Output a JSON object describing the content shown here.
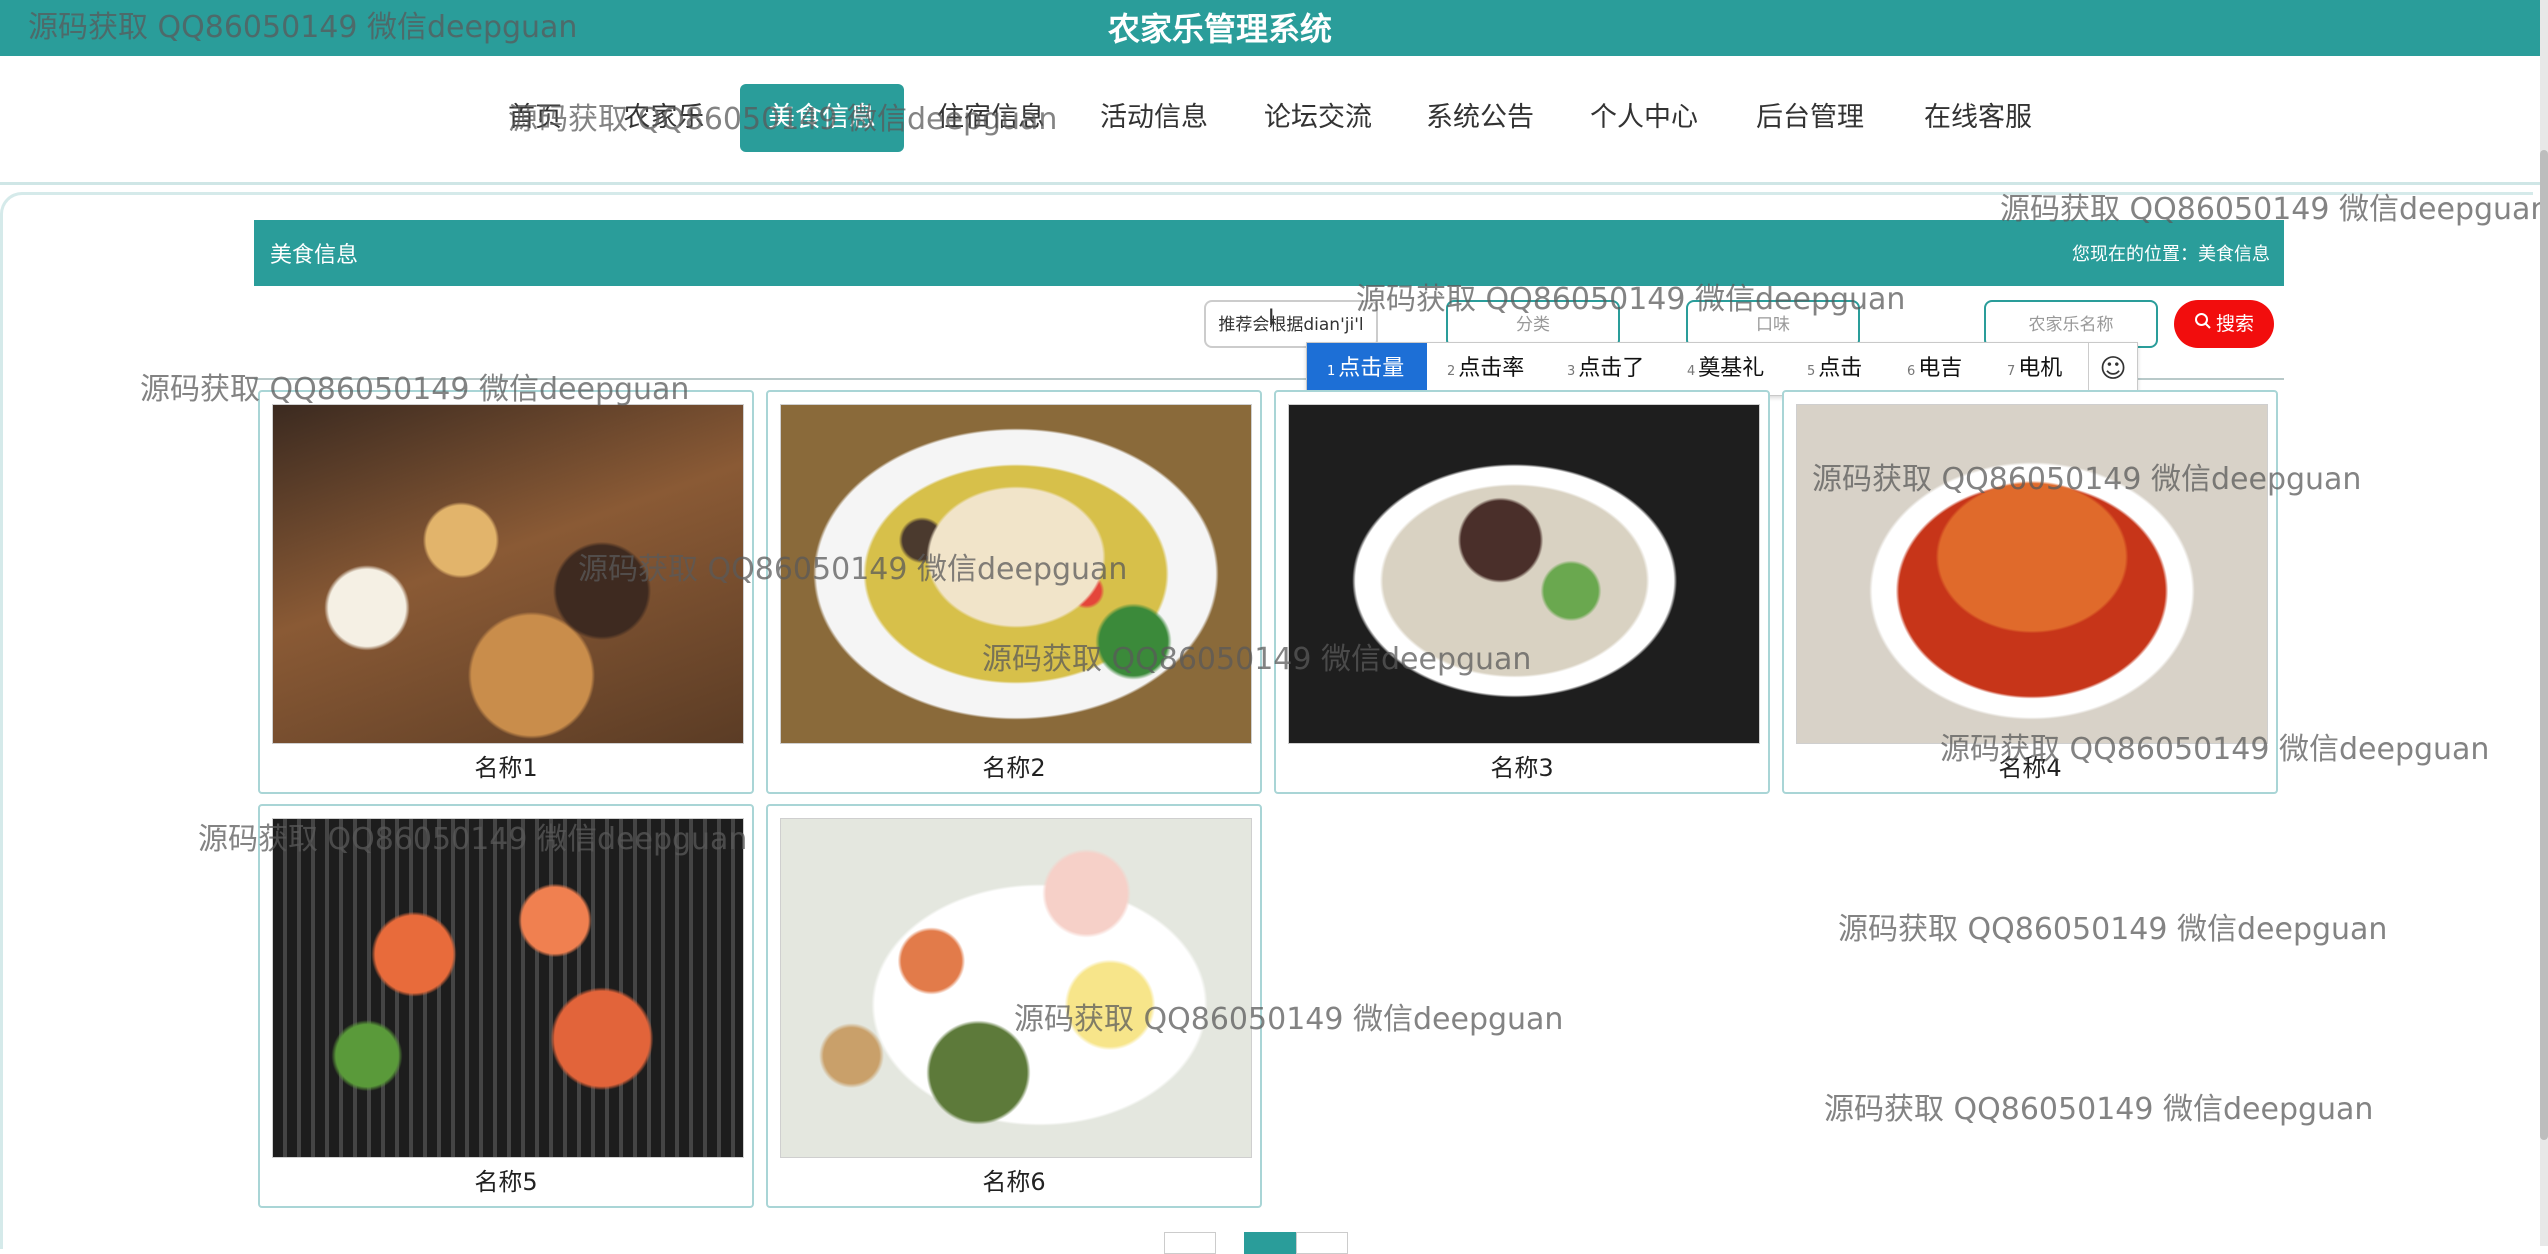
{
  "header": {
    "app_title": "农家乐管理系统"
  },
  "nav": {
    "items": [
      {
        "key": "home",
        "label": "首页"
      },
      {
        "key": "farmstay",
        "label": "农家乐"
      },
      {
        "key": "food",
        "label": "美食信息",
        "active": true
      },
      {
        "key": "lodging",
        "label": "住宿信息"
      },
      {
        "key": "activity",
        "label": "活动信息"
      },
      {
        "key": "forum",
        "label": "论坛交流"
      },
      {
        "key": "notice",
        "label": "系统公告"
      },
      {
        "key": "profile",
        "label": "个人中心"
      },
      {
        "key": "admin",
        "label": "后台管理"
      },
      {
        "key": "service",
        "label": "在线客服"
      }
    ]
  },
  "section": {
    "title": "美食信息",
    "breadcrumb": "您现在的位置：美食信息"
  },
  "search": {
    "recommend_value": "推荐会根据dian'ji'l",
    "category_placeholder": "分类",
    "taste_placeholder": "口味",
    "farmstay_placeholder": "农家乐名称",
    "button_label": "搜索",
    "button_icon": "search-icon"
  },
  "ime": {
    "candidates": [
      {
        "num": "1",
        "text": "点击量"
      },
      {
        "num": "2",
        "text": "点击率"
      },
      {
        "num": "3",
        "text": "点击了"
      },
      {
        "num": "4",
        "text": "奠基礼"
      },
      {
        "num": "5",
        "text": "点击"
      },
      {
        "num": "6",
        "text": "电吉"
      },
      {
        "num": "7",
        "text": "电机"
      }
    ],
    "emoji": "☺"
  },
  "foods": [
    {
      "name": "名称1"
    },
    {
      "name": "名称2"
    },
    {
      "name": "名称3"
    },
    {
      "name": "名称4"
    },
    {
      "name": "名称5"
    },
    {
      "name": "名称6"
    }
  ],
  "watermark": "源码获取 QQ86050149 微信deepguan",
  "colors": {
    "primary": "#2a9d9a",
    "search_button": "#f20d0d",
    "ime_selected": "#1d6fd6"
  }
}
